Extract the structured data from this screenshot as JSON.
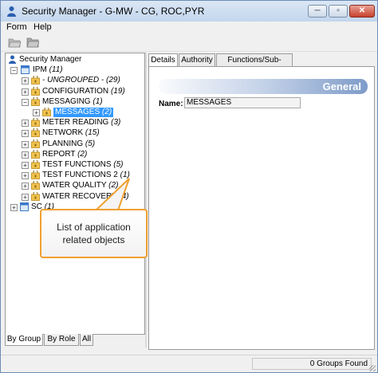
{
  "window": {
    "title": "Security Manager - G-MW - CG, ROC,PYR",
    "controls": {
      "minimize": "─",
      "maximize": "▫",
      "close": "✕"
    }
  },
  "menu": [
    "Form",
    "Help"
  ],
  "toolbar": {
    "buttons": [
      "open-icon",
      "save-icon"
    ]
  },
  "tree": {
    "root": "Security Manager",
    "nodes": [
      {
        "label": "IPM",
        "count": "(11)",
        "expanded": true
      },
      {
        "label": "- UNGROUPED -",
        "count": "(29)",
        "italic": true
      },
      {
        "label": "CONFIGURATION",
        "count": "(19)"
      },
      {
        "label": "MESSAGING",
        "count": "(1)",
        "expanded": true
      },
      {
        "label": "MESSAGES",
        "count": "(2)",
        "selected": true
      },
      {
        "label": "METER READING",
        "count": "(3)"
      },
      {
        "label": "NETWORK",
        "count": "(15)"
      },
      {
        "label": "PLANNING",
        "count": "(5)"
      },
      {
        "label": "REPORT",
        "count": "(2)"
      },
      {
        "label": "TEST FUNCTIONS",
        "count": "(5)"
      },
      {
        "label": "TEST FUNCTIONS 2",
        "count": "(1)"
      },
      {
        "label": "WATER QUALITY",
        "count": "(2)"
      },
      {
        "label": "WATER RECOVERY",
        "count": "(4)"
      },
      {
        "label": "SC",
        "count": "(1)"
      }
    ]
  },
  "bottom_tabs": [
    "By Group",
    "By Role",
    "All"
  ],
  "detail_tabs": [
    "Details",
    "Authority",
    "Functions/Sub-Groups"
  ],
  "details": {
    "section_title": "General",
    "name_label": "Name:",
    "name_value": "MESSAGES"
  },
  "callout": {
    "line1": "List of application",
    "line2": "related objects"
  },
  "status": {
    "groups_found": "0 Groups Found"
  },
  "colors": {
    "selection": "#3399ff",
    "callout_border": "#f0a030",
    "banner_end": "#7e9cc9"
  }
}
